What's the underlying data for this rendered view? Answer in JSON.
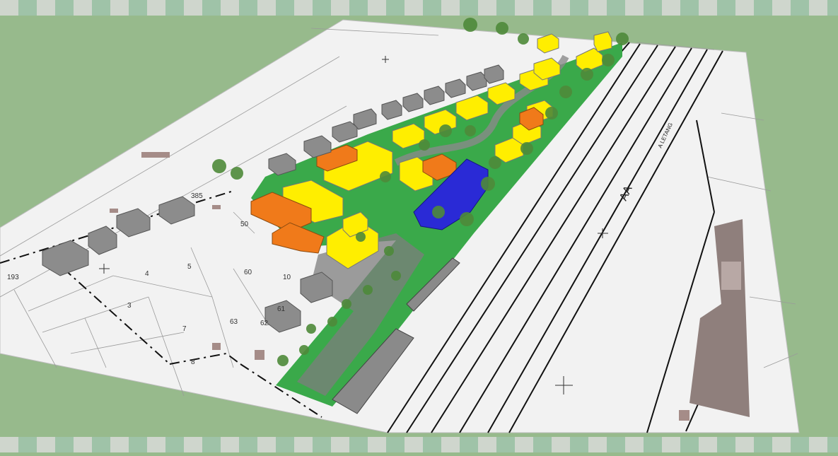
{
  "scene": {
    "background_color": "#97ba8c",
    "paper_color": "#f2f2f2",
    "green_color": "#3aa94a",
    "yellow_color": "#ffee00",
    "orange_color": "#f07a1a",
    "blue_color": "#2a2ad6",
    "grey_building_color": "#8c8c8c",
    "track_color": "#111111",
    "frame_colors": [
      "#cfd6cd",
      "#9fc3a8"
    ]
  },
  "labels": {
    "rail_code": "AA",
    "street_name": "A LETANG",
    "parcel_193": "193",
    "parcel_4": "4",
    "parcel_3": "3",
    "parcel_5": "5",
    "parcel_60": "60",
    "parcel_10": "10",
    "parcel_61": "61",
    "parcel_62": "62",
    "parcel_63": "63",
    "parcel_7": "7",
    "parcel_8": "8",
    "parcel_50": "50",
    "parcel_385": "385"
  }
}
